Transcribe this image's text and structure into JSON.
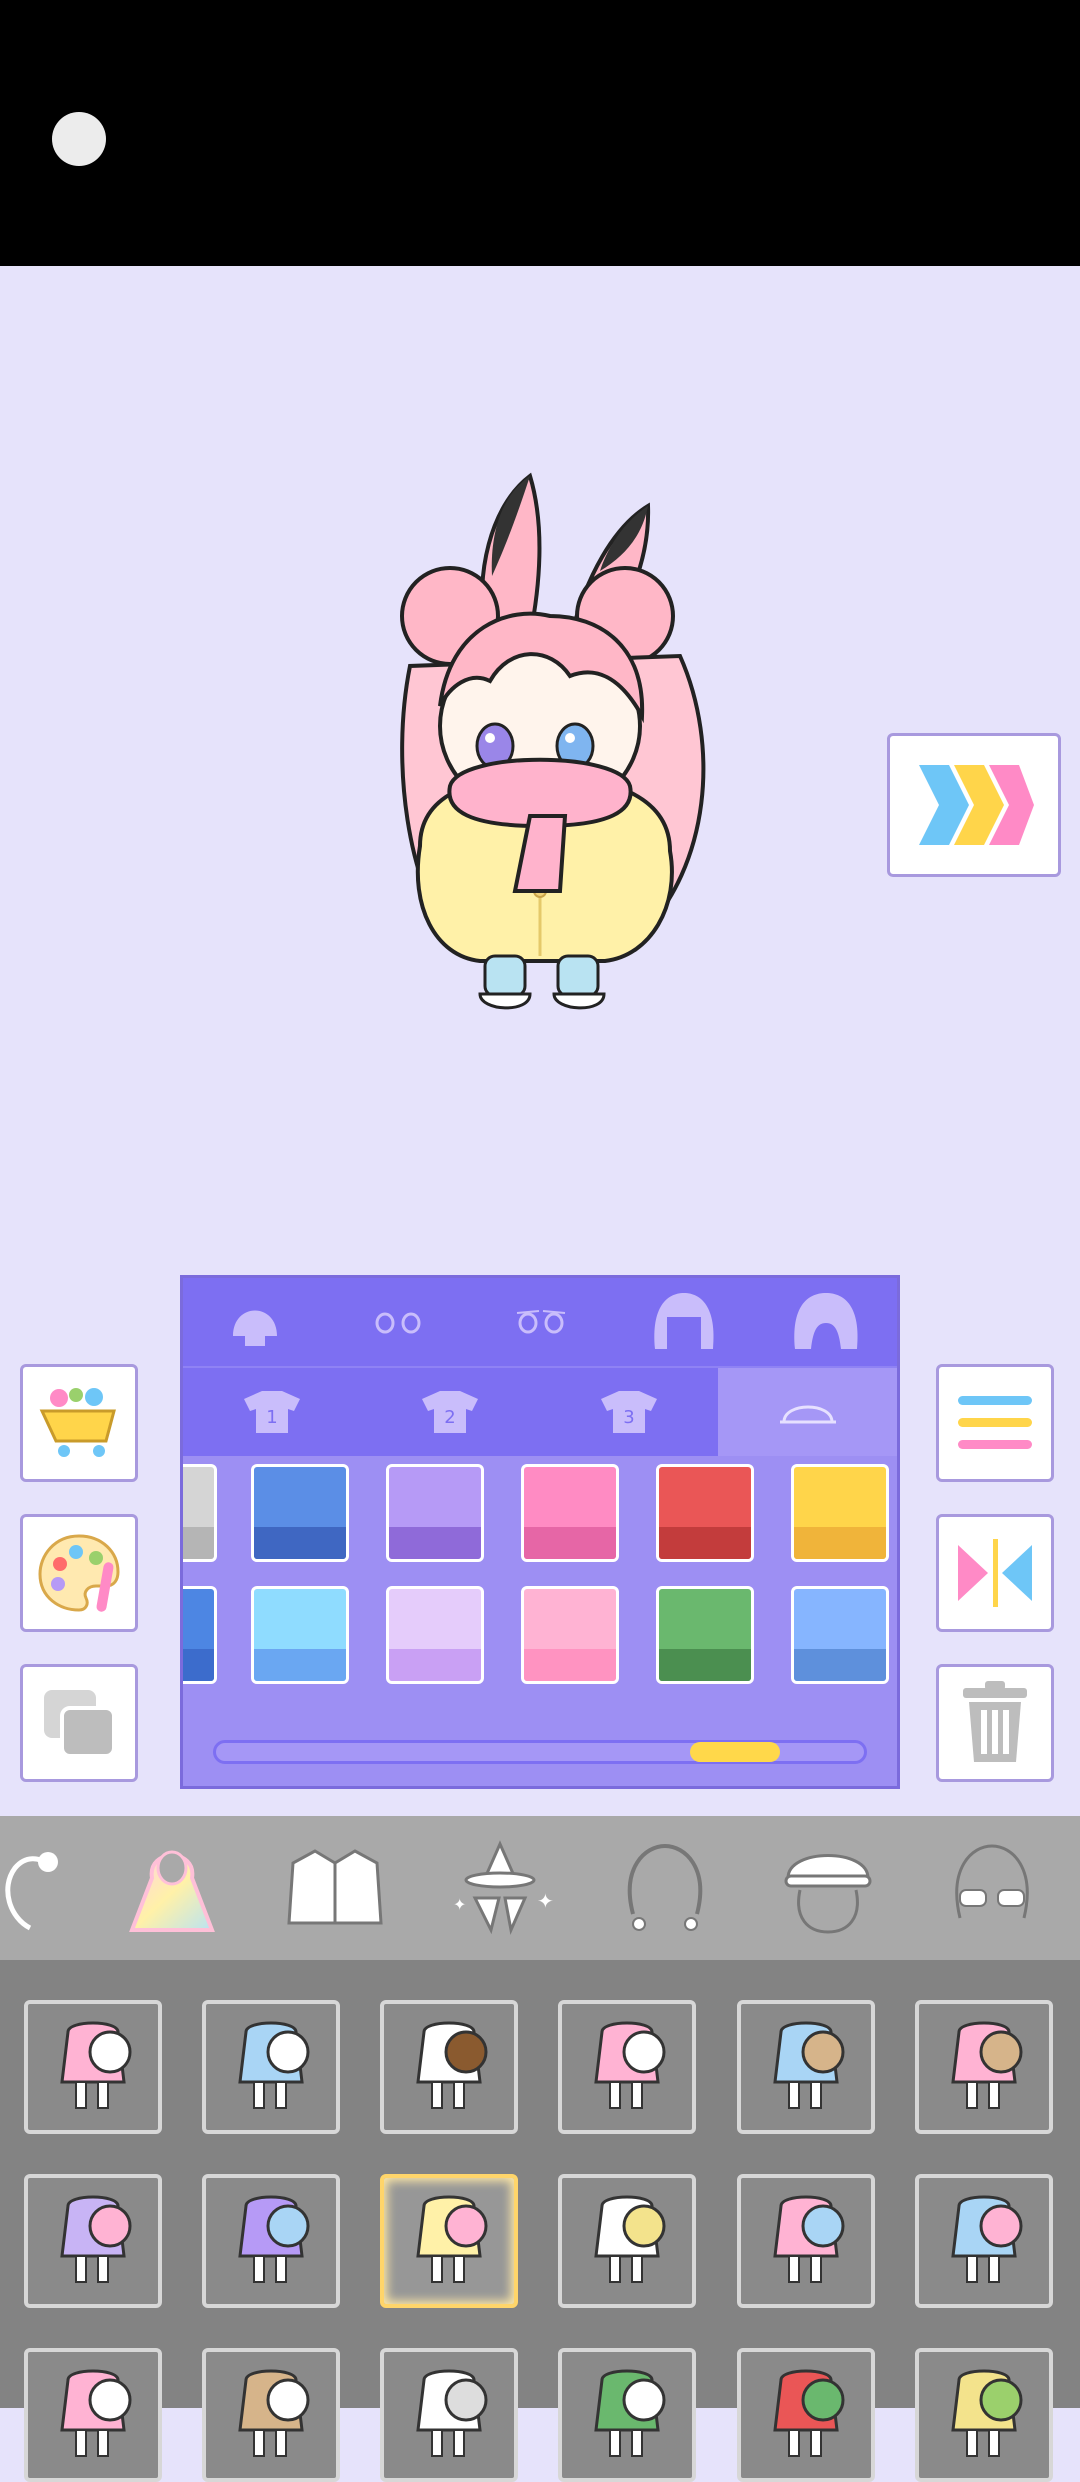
{
  "status_bar": {
    "camera_icon": "camera-dot"
  },
  "character": {
    "description_icon": "chibi-bunny-girl"
  },
  "next_button": {
    "icon": "triple-chevron-right-icon",
    "colors": [
      "#6ec6f7",
      "#ffd54a",
      "#ff8ac6"
    ]
  },
  "left_tools": [
    {
      "name": "shop",
      "icon": "shopping-cart-icon"
    },
    {
      "name": "palette",
      "icon": "paint-palette-icon"
    },
    {
      "name": "layers",
      "icon": "layers-icon"
    }
  ],
  "right_tools": [
    {
      "name": "menu",
      "icon": "menu-lines-icon"
    },
    {
      "name": "flip",
      "icon": "flip-horizontal-icon"
    },
    {
      "name": "delete",
      "icon": "trash-icon"
    }
  ],
  "panel": {
    "row1": [
      "head",
      "eyes-1",
      "eyes-2",
      "hair-front",
      "hair-back"
    ],
    "row2": [
      {
        "label": "1",
        "icon": "shirt-icon"
      },
      {
        "label": "2",
        "icon": "shirt-icon"
      },
      {
        "label": "3",
        "icon": "shirt-icon"
      },
      {
        "label": "",
        "icon": "hat-icon",
        "selected": true
      }
    ],
    "swatches_row1": [
      {
        "top": "#d5d5d5",
        "bottom": "#b5b5b5"
      },
      {
        "top": "#5b8ee6",
        "bottom": "#3f67c2"
      },
      {
        "top": "#b69af6",
        "bottom": "#8f6ad9"
      },
      {
        "top": "#ff8bc3",
        "bottom": "#e666a6"
      },
      {
        "top": "#ea5656",
        "bottom": "#c33c3c"
      },
      {
        "top": "#ffd54a",
        "bottom": "#f0b43a"
      }
    ],
    "swatches_row2": [
      {
        "top": "#4d86e3",
        "bottom": "#3c6ccc"
      },
      {
        "top": "#8fdcff",
        "bottom": "#6aa7f2"
      },
      {
        "top": "#e5ccfb",
        "bottom": "#c9a0f4"
      },
      {
        "top": "#ffb3d3",
        "bottom": "#ff93c1"
      },
      {
        "top": "#6ab86e",
        "bottom": "#4b8f50"
      },
      {
        "top": "#86b5ff",
        "bottom": "#5e90dc"
      }
    ],
    "scroll_progress": 0.85
  },
  "categories": [
    {
      "name": "hair-partial",
      "icon": "hair-icon"
    },
    {
      "name": "outerwear",
      "icon": "hoodie-icon",
      "selected": true
    },
    {
      "name": "jacket",
      "icon": "jacket-icon"
    },
    {
      "name": "accessories",
      "icon": "witch-hat-icon"
    },
    {
      "name": "earrings",
      "icon": "earrings-icon"
    },
    {
      "name": "hat",
      "icon": "cap-icon"
    },
    {
      "name": "glasses",
      "icon": "glasses-icon"
    }
  ],
  "items": [
    [
      {
        "name": "snowball-pink",
        "colors": [
          "#ffb3d3",
          "#ffffff"
        ]
      },
      {
        "name": "snowball-blue",
        "colors": [
          "#a9d5f5",
          "#ffffff"
        ]
      },
      {
        "name": "snowman",
        "colors": [
          "#ffffff",
          "#8a5a2f"
        ]
      },
      {
        "name": "rolling-snowball",
        "colors": [
          "#ffb3d3",
          "#ffffff"
        ]
      },
      {
        "name": "blue-coat",
        "colors": [
          "#a9d5f5",
          "#d6b48a"
        ]
      },
      {
        "name": "pink-coat",
        "colors": [
          "#ffb3d3",
          "#d6b48a"
        ]
      }
    ],
    [
      {
        "name": "purple-dress-doll",
        "colors": [
          "#c8b4f5",
          "#ffb3d3"
        ]
      },
      {
        "name": "purple-scarf",
        "colors": [
          "#b69af6",
          "#a9d5f5"
        ]
      },
      {
        "name": "yellow-coat-scarf",
        "colors": [
          "#fff1a8",
          "#ffb3d3"
        ],
        "selected": true
      },
      {
        "name": "snow-bunny",
        "colors": [
          "#ffffff",
          "#f3e38c"
        ]
      },
      {
        "name": "pink-pose",
        "colors": [
          "#ffb3d3",
          "#a9d5f5"
        ]
      },
      {
        "name": "blue-pose",
        "colors": [
          "#a9d5f5",
          "#ffb3d3"
        ]
      }
    ],
    [
      {
        "name": "net",
        "colors": [
          "#ffb3d3",
          "#ffffff"
        ]
      },
      {
        "name": "bag",
        "colors": [
          "#d6b48a",
          "#ffffff"
        ]
      },
      {
        "name": "white-top",
        "colors": [
          "#ffffff",
          "#dddddd"
        ]
      },
      {
        "name": "green-top",
        "colors": [
          "#6ab86e",
          "#ffffff"
        ]
      },
      {
        "name": "watermelon",
        "colors": [
          "#ea5656",
          "#6ab86e"
        ]
      },
      {
        "name": "fruit",
        "colors": [
          "#f3e38c",
          "#9bd06c"
        ]
      }
    ]
  ]
}
